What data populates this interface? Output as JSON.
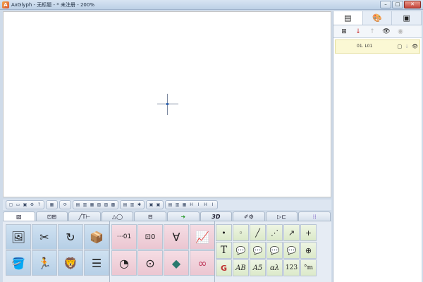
{
  "window": {
    "title": "AxGlyph - 无标题 - * 未注册 - 200%",
    "app_icon": "A",
    "buttons": {
      "minimize": "–",
      "maximize": "□",
      "close": "✕"
    }
  },
  "right_panel": {
    "tabs": [
      {
        "icon": "layers-icon",
        "glyph": "▤"
      },
      {
        "icon": "palette-icon",
        "glyph": "🎨"
      },
      {
        "icon": "library-icon",
        "glyph": "▣"
      }
    ],
    "toolbar": [
      {
        "icon": "add-layer-icon",
        "glyph": "⊞"
      },
      {
        "icon": "move-down-icon",
        "glyph": "↓"
      },
      {
        "icon": "move-up-icon",
        "glyph": "↑"
      },
      {
        "icon": "show-icon",
        "glyph": "👁"
      },
      {
        "icon": "hide-icon",
        "glyph": "◉"
      }
    ],
    "layer": {
      "name": "01. L01",
      "icons": [
        "▢",
        "↓",
        "👁"
      ]
    }
  },
  "toolbar_groups": [
    [
      "▢",
      "▭",
      "▣",
      "⚙",
      "?"
    ],
    [
      "▦"
    ],
    [
      "⟳"
    ],
    [
      "▤",
      "▥",
      "▦",
      "▧",
      "▨",
      "▩"
    ],
    [
      "▤",
      "▥",
      "✱"
    ],
    [
      "▣",
      "▣"
    ],
    [
      "▤",
      "▥",
      "▦",
      "H",
      "I",
      "H",
      "I"
    ]
  ],
  "category_tabs": [
    {
      "label": "▧",
      "icon": "basic-shapes-icon"
    },
    {
      "label": "⊡⊞",
      "icon": "charts-icon"
    },
    {
      "label": "╱T⊢",
      "icon": "lines-text-icon"
    },
    {
      "label": "△◯",
      "icon": "shapes-icon"
    },
    {
      "label": "⊟",
      "icon": "blocks-icon"
    },
    {
      "label": "➜",
      "icon": "arrows-icon"
    },
    {
      "label": "3D",
      "icon": "3d-icon"
    },
    {
      "label": "✐⚙",
      "icon": "tools-icon"
    },
    {
      "label": "▷⊏",
      "icon": "flow-icon"
    },
    {
      "label": "⁞⁞",
      "icon": "more-icon"
    }
  ],
  "palette": {
    "group1": [
      "🖼",
      "✂",
      "↻",
      "📦",
      "🪣",
      "🏃",
      "🦁",
      "☰"
    ],
    "group2": [
      "⋯01",
      "⊡0",
      "∀",
      "📈",
      "◔",
      "⊙",
      "◆",
      "∞"
    ],
    "group3": [
      "•",
      "◦",
      "╱",
      "⋰",
      "↗",
      "+",
      "T",
      "💬",
      "💬",
      "💬",
      "💬",
      "⊕",
      "G",
      "AB",
      "A5",
      "αλ",
      "123",
      "°m"
    ]
  }
}
